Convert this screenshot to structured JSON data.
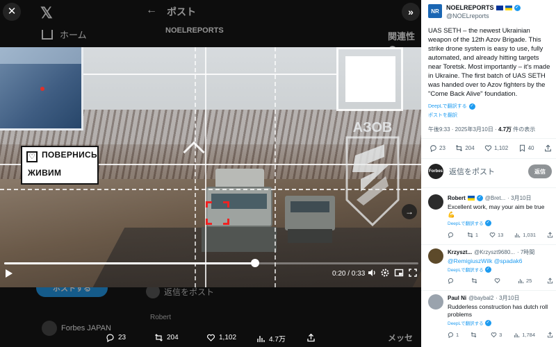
{
  "background": {
    "header_title": "ポスト",
    "home_label": "ホーム",
    "account_label": "NOELREPORTS",
    "related_label": "関連性の",
    "post_button_label": "ポストする",
    "reply_placeholder": "返信をポスト",
    "forbes_jp": "Forbes JAPAN",
    "robert_line": "Robert",
    "messages_label": "メッセ"
  },
  "video": {
    "overlay_logo_line1": "ПОВЕРНИСЬ",
    "overlay_logo_line2": "ЖИВИМ",
    "azov_text": "АЗОВ",
    "time_label": "0:20 / 0:33",
    "progress_fraction": 0.606
  },
  "bottom_bar": {
    "replies": "23",
    "reposts": "204",
    "likes": "1,102",
    "views": "4.7万"
  },
  "post": {
    "author_name": "NOELREPORTS",
    "author_handle": "@NOELreports",
    "text": "UAS SETH – the newest Ukrainian weapon of the 12th Azov Brigade. This strike drone system is easy to use, fully automated, and already hitting targets near Toretsk. Most importantly – it's made in Ukraine. The first batch of UAS SETH was handed over to Azov fighters by the \"Come Back Alive\" foundation.",
    "deepl_label": "DeepLで翻訳する",
    "translate_label": "ポストを翻訳",
    "meta_time": "午後9:33 · 2025年3月10日 · ",
    "meta_views_bold": "4.7万",
    "meta_views_suffix": " 件の表示",
    "replies": "23",
    "reposts": "204",
    "likes": "1,102",
    "bookmarks": "40"
  },
  "reply_box": {
    "avatar_label": "Forbes",
    "placeholder": "返信をポスト",
    "button_label": "返信"
  },
  "comments": [
    {
      "name": "Robert",
      "handle": "@Bret...",
      "time": "· 3月10日",
      "text": "Excellent work, may your aim be true 💪",
      "deepl": "DeepLで翻訳する",
      "replies": "",
      "reposts": "1",
      "likes": "13",
      "views": "1,031"
    },
    {
      "name": "Krzyszt...",
      "handle": "@Krzyszt9680...",
      "time": "· 7時間",
      "text": "@RemigiuszWilk @spadak6",
      "deepl": "DeepLで翻訳する",
      "replies": "",
      "reposts": "",
      "likes": "",
      "views": "25"
    },
    {
      "name": "Paul Ni",
      "handle": "@baybal2",
      "time": "· 3月10日",
      "text": "Rudderless construction has dutch roll problems",
      "deepl": "DeepLで翻訳する",
      "replies": "1",
      "reposts": "",
      "likes": "3",
      "views": "1,784"
    }
  ],
  "colors": {
    "accent": "#1d9bf0",
    "reticle": "#e22222",
    "right_pane_bg": "#ffffff",
    "media_bg": "#0d0d0d"
  }
}
